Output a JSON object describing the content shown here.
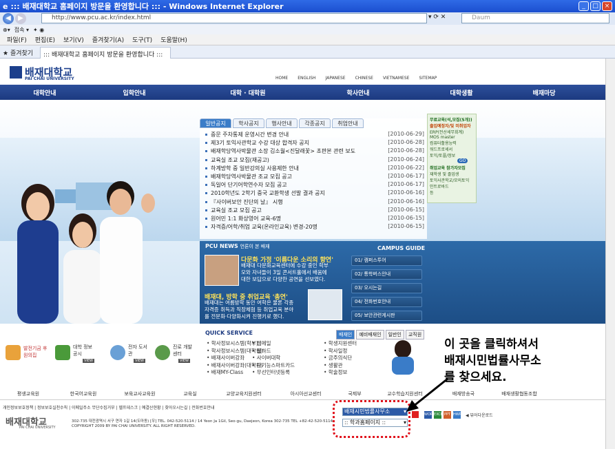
{
  "window": {
    "title": "::: 배재대학교 홈페이지 방문을 환영합니다 ::: - Windows Internet Explorer"
  },
  "browser": {
    "url": "http://www.pcu.ac.kr/index.html",
    "search_placeholder": "Daum",
    "toolbar": [
      "접속 ▾"
    ],
    "menu": [
      "파일(F)",
      "편집(E)",
      "보기(V)",
      "즐겨찾기(A)",
      "도구(T)",
      "도움말(H)"
    ],
    "favorites_label": "즐겨찾기",
    "tab_title": "::: 배재대학교 홈페이지 방문을 환영합니다 :::"
  },
  "site": {
    "logo": "배재대학교",
    "logo_sub": "PAI CHAI UNIVERSITY",
    "toplinks": [
      "HOME",
      "ENGLISH",
      "JAPANESE",
      "CHINESE",
      "VIETNAMESE",
      "SITEMAP"
    ],
    "gnb": [
      "대학안내",
      "입학안내",
      "대학 · 대학원",
      "학사안내",
      "대학생활",
      "배재마당"
    ],
    "notice_tabs": [
      "일반공지",
      "학사공지",
      "행사안내",
      "각종공지",
      "취업안내"
    ],
    "notices": [
      {
        "title": "중문 주차통제 운영시간 변경 안내",
        "date": "[2010-06-29]"
      },
      {
        "title": "제3기 토익사관학교 수강 대상 합격자 공지",
        "date": "[2010-06-28]"
      },
      {
        "title": "배재학당역사박물관 소장 김소월<진달래꽃> 초판본 관련 보도",
        "date": "[2010-06-28]"
      },
      {
        "title": "교육실 조교 모집(재공고)",
        "date": "[2010-06-24]"
      },
      {
        "title": "하계방학 중 일반강의실 사용제한 안내",
        "date": "[2010-06-22]"
      },
      {
        "title": "배재학당역사박물관 조교 모집 공고",
        "date": "[2010-06-17]"
      },
      {
        "title": "독일어 단기어학연수자 모집 공고",
        "date": "[2010-06-17]"
      },
      {
        "title": "2010학년도 2학기 중국 교환학생 선발 결과 공지",
        "date": "[2010-06-16]"
      },
      {
        "title": "『사이버보안 진단의 날』 시행",
        "date": "[2010-06-16]"
      },
      {
        "title": "교육실 조교 모집 공고",
        "date": "[2010-06-15]"
      },
      {
        "title": "원어민 1:1 화상영어 교육-6명",
        "date": "[2010-06-15]"
      },
      {
        "title": "자격증/어학/취업 교육(온라인교육) 변경-20명",
        "date": "[2010-06-15]"
      }
    ],
    "banner_right": [
      "무료교육(석,모집(5개))",
      "출입예정자/및 미취업자",
      "ERP(전산세무회계)",
      "MOS master",
      "컴퓨터활용능력",
      "워드프로세서",
      "토익/토플/정보",
      "GO",
      "취업교육 참가자모집",
      "재학생 및 졸업생",
      "토익사관학교/모의토익",
      "인트로바드",
      "등"
    ],
    "news": {
      "header": "PCU NEWS",
      "header_sub": "언론이 본 배재",
      "item1_title": "다문화 가정 '이름다운 소리의 향연'",
      "item1_body": [
        "배재대 다문화교육센터에 수강 중인 학부",
        "모와 자녀들이 3일 콘서트홀에서 배움에",
        "대한 보답으로 다양한 공연을 선보였다."
      ],
      "item2_title": "배재대, 방학 중 취업교육 '총연'",
      "item2_body": [
        "배재대는 여름방학 동안 여학은 물론 각종",
        "자격증 취득과 직장체험 등 취업교육 분야",
        "를 전문화·다양화시켜 진행키로 했다."
      ]
    },
    "campus_guide": {
      "title": "CAMPUS GUIDE",
      "items": [
        "01/  캠퍼스투어",
        "02/  통학버스안내",
        "03/  오시는길",
        "04/  전화번호안내",
        "05/  보안관련게시판"
      ]
    },
    "quick_icons": [
      {
        "label": "발전기금 후원의집"
      },
      {
        "label": "대학 정보공시",
        "badge": "VIEW"
      },
      {
        "label": "전자 도서관",
        "badge": "VIEW"
      },
      {
        "label": "진로 개발센터",
        "badge": "VIEW"
      }
    ],
    "quick_service": {
      "title": "QUICK SERVICE",
      "tabs": [
        "배재인",
        "예비배재인",
        "일반인",
        "교직원"
      ],
      "col1": [
        "학사정보시스템(학부)",
        "학사정보시스템(대학원)",
        "배재사이버강좌",
        "배재사이버강좌(대학원)",
        "배재MY-Class"
      ],
      "col2": [
        "웹메일",
        "웹하드",
        "사이버대학",
        "다기능스마트카드",
        "무선인터넷등록"
      ],
      "col3": [
        "학생지원센터",
        "학사일정",
        "금주의식단",
        "생활관",
        "학술정보"
      ]
    },
    "bottom_menu": [
      "평생교육원",
      "한국어교육원",
      "보육교사교육원",
      "교육실",
      "교양교육지원센터",
      "아시아선교센터",
      "국제부",
      "교수학습지원센터",
      "배재방송국",
      "배재생활협동조합"
    ],
    "footer": {
      "links": "개인정보보호정책  |  정보보호실천수칙  |  이메일주소 무단수집거부  |  헬프데스크  |  예결산현황  |  찾아오시는길  |  전화번호안내",
      "logo": "배재대학교",
      "logo_sub": "PAI CHAI UNIVERSITY",
      "address": "302-735 대전광역시 서구 연자 1길 14(도마동) [우] TEL. 042-520-5114 / 14 Yeon Ja 1Gil, Seo-gu, Daejeon, Korea 302-735 TEL +82-42-520-5114",
      "copyright": "COPYRIGHT 2009 BY PAI CHAI UNIVERSITY. ALL RIGHT RESERVED.",
      "select1": "배재시민법률사무소",
      "select2": ":: 학과홈페이지 ::",
      "download_label": "◀ 뷰어다운로드",
      "file_icons": [
        "WORD",
        "EXCEL",
        "PPT",
        "HWP"
      ]
    }
  },
  "annotation": {
    "text": "이 곳을 클릭하셔서\n배재시민법률사무소\n를 찾으세요."
  }
}
